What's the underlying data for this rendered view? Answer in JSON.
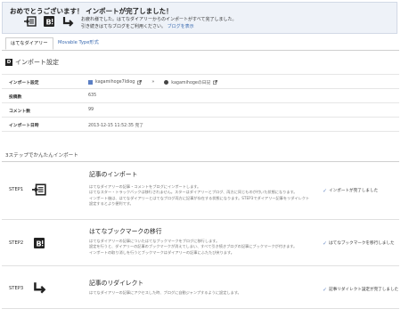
{
  "banner": {
    "title": "おめでとうございます！ インポートが完了しました！",
    "line1": "お疲れ様でした。はてなダイアリーからのインポートがすべて完了しました。",
    "line2": "引き続きはてなブログをご利用ください。",
    "link": "ブログを表示",
    "icons": [
      "import-icon",
      "bookmark-b-icon",
      "redirect-arrow-icon"
    ]
  },
  "tabs": {
    "active": "はてなダイアリー",
    "inactive": "Movable Type形式"
  },
  "section": {
    "badge": "D",
    "title": "インポート設定"
  },
  "info": {
    "rows": [
      {
        "label": "インポート設定",
        "source": "kagamihoge7ldiog",
        "arrow": "»",
        "dest": "kagamihogeの日記"
      },
      {
        "label": "投稿数",
        "value": "635"
      },
      {
        "label": "コメント数",
        "value": "99"
      },
      {
        "label": "インポート日時",
        "value": "2013-12-15 11:52:35 完了"
      }
    ]
  },
  "steps": {
    "title": "3ステップでかんたんインポート",
    "items": [
      {
        "label": "STEP1",
        "title": "記事のインポート",
        "desc1": "はてなダイアリーの記事・コメントをブログにインポートします。",
        "desc2": "はてなスター・トラックバックは移行されません。スターはダイアリーとブログ、両方に同じものが付いた状態になります。",
        "desc3": "インポート後は、はてなダイアリーとはてなブログ両方に記事が存在する状態になります。STEP3でダイアリー記事をリダイレクト",
        "desc4": "設定するとより便利です。",
        "status": "インポートが完了しました"
      },
      {
        "label": "STEP2",
        "title": "はてなブックマークの移行",
        "desc1": "はてなダイアリーの記事についたはてなブックマークをブログに移行します。",
        "desc2": "設定を行うと、ダイアリーの記事のブックマークが消えてしまい、すべて引き続きブログの記事にブックマークが付きます。",
        "desc3": "インポートの取り消しを行うとブックマークはダイアリーの記事にふたたび戻ります。",
        "status": "はてなブックマークを移行しました"
      },
      {
        "label": "STEP3",
        "title": "記事のリダイレクト",
        "desc1": "はてなダイアリーの記事にアクセスした時、ブログに自動ジャンプするように設定します。",
        "status": "記事リダイレクト設定が完了しました"
      }
    ]
  }
}
